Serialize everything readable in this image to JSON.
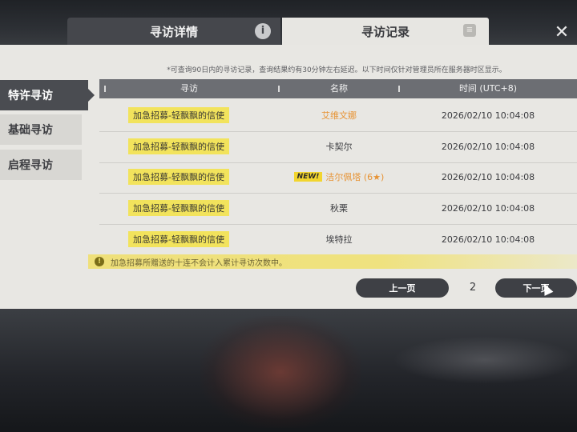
{
  "tabs": {
    "detail_label": "寻访详情",
    "record_label": "寻访记录"
  },
  "notice": "*可查询90日内的寻访记录，查询结果约有30分钟左右延迟。以下时间仅针对管理员所在服务器时区显示。",
  "sidebar": {
    "items": [
      {
        "label": "特许寻访"
      },
      {
        "label": "基础寻访"
      },
      {
        "label": "启程寻访"
      }
    ]
  },
  "table": {
    "headers": [
      "寻访",
      "名称",
      "时间 (UTC+8)"
    ],
    "rows": [
      {
        "type": "加急招募-轻飘飘的信使",
        "badge": "",
        "name": "艾维文娜",
        "time": "2026/02/10 10:04:08"
      },
      {
        "type": "加急招募-轻飘飘的信使",
        "badge": "",
        "name": "卡契尔",
        "time": "2026/02/10 10:04:08"
      },
      {
        "type": "加急招募-轻飘飘的信使",
        "badge": "NEW!",
        "name": "洁尔佩塔 (6★)",
        "time": "2026/02/10 10:04:08"
      },
      {
        "type": "加急招募-轻飘飘的信使",
        "badge": "",
        "name": "秋栗",
        "time": "2026/02/10 10:04:08"
      },
      {
        "type": "加急招募-轻飘飘的信使",
        "badge": "",
        "name": "埃特拉",
        "time": "2026/02/10 10:04:08"
      }
    ]
  },
  "warning": "加急招募所赠送的十连不会计入累计寻访次数中。",
  "pagination": {
    "prev_label": "上一页",
    "next_label": "下一页",
    "current_page": "2"
  },
  "colors": {
    "highlight_yellow": "#f2e35c",
    "rare_orange": "#e79334",
    "dark_button": "#3e4045"
  }
}
